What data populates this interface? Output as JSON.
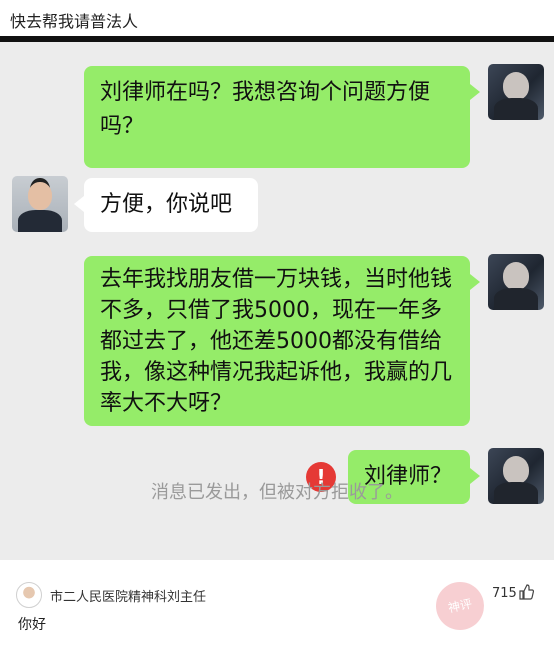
{
  "post": {
    "title": "快去帮我请普法人"
  },
  "chat": {
    "messages": [
      {
        "sender": "me",
        "text": "刘律师在吗？我想咨询个问题方便吗？"
      },
      {
        "sender": "lawyer",
        "text": "方便，你说吧"
      },
      {
        "sender": "me",
        "text": "去年我找朋友借一万块钱，当时他钱不多，只借了我5000，现在一年多都过去了，他还差5000都没有借给我，像这种情况我起诉他，我赢的几率大不大呀？"
      },
      {
        "sender": "me",
        "text": "刘律师？",
        "status": "failed"
      }
    ],
    "error_icon": "!",
    "system_note": "消息已发出，但被对方拒收了。"
  },
  "comment": {
    "author": "市二人民医院精神科刘主任",
    "likes": "715",
    "text": "你好",
    "like_icon": "thumbs-up-icon"
  },
  "watermark": {
    "text": "神评"
  },
  "colors": {
    "bubble_green": "#95ec69",
    "chat_background": "#ececec",
    "error_red": "#e53935"
  }
}
